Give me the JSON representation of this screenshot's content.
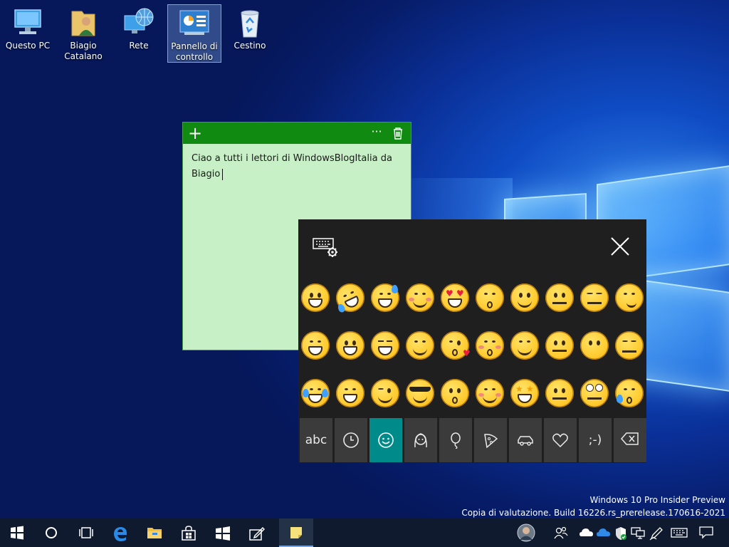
{
  "desktop": {
    "icons": [
      {
        "label": "Questo PC",
        "icon": "computer-icon"
      },
      {
        "label": "Biagio Catalano",
        "icon": "user-folder-icon"
      },
      {
        "label": "Rete",
        "icon": "network-icon"
      },
      {
        "label": "Pannello di controllo",
        "icon": "control-panel-icon",
        "selected": true
      },
      {
        "label": "Cestino",
        "icon": "recycle-bin-icon"
      }
    ]
  },
  "sticky_note": {
    "header_color": "#108a10",
    "body_color": "#c8f0c6",
    "add_icon": "plus-icon",
    "more_icon": "ellipsis-icon",
    "delete_icon": "trash-icon",
    "text_line1": "Ciao a tutti i lettori di WindowsBlogItalia da",
    "text_line2": "Biagio"
  },
  "emoji_keyboard": {
    "settings_icon": "keyboard-settings-icon",
    "close_icon": "close-icon",
    "emoji_rows": [
      [
        "grinning",
        "rofl",
        "sweat-smile",
        "smile-blush",
        "heart-eyes",
        "kissing-smiling",
        "slight-smile",
        "thinking",
        "expressionless",
        "smirk"
      ],
      [
        "grin",
        "smiley",
        "squint-laugh",
        "yum",
        "kiss-heart",
        "kissing-blush",
        "hug",
        "raised-brow",
        "no-mouth",
        "persevere"
      ],
      [
        "joy",
        "smile",
        "wink",
        "sunglasses",
        "kissing",
        "relaxed",
        "star-struck",
        "neutral",
        "eye-roll",
        "disappointed-relieved"
      ]
    ],
    "categories": [
      {
        "name": "abc",
        "label": "abc"
      },
      {
        "name": "recent",
        "icon": "clock-icon"
      },
      {
        "name": "smileys",
        "icon": "smiley-icon",
        "active": true
      },
      {
        "name": "people",
        "icon": "person-icon"
      },
      {
        "name": "celebration",
        "icon": "balloon-icon"
      },
      {
        "name": "food",
        "icon": "pizza-icon"
      },
      {
        "name": "travel",
        "icon": "car-icon"
      },
      {
        "name": "symbols",
        "icon": "heart-icon"
      },
      {
        "name": "emoticons",
        "label": ";-)"
      },
      {
        "name": "backspace",
        "icon": "backspace-icon"
      }
    ],
    "active_color": "#008b8b"
  },
  "watermark": {
    "line1": "Windows 10 Pro Insider Preview",
    "line2": "Copia di valutazione. Build 16226.rs_prerelease.170616-2021"
  },
  "taskbar": {
    "items": [
      "start-icon",
      "cortana-icon",
      "task-view-icon",
      "edge-icon",
      "file-explorer-icon",
      "store-icon",
      "windows-logo-app-icon",
      "ink-workspace-icon",
      "sticky-notes-icon"
    ],
    "tray": [
      "profile-avatar-icon",
      "people-icon",
      "onedrive-icon",
      "onedrive-blue-icon",
      "defender-icon",
      "network-icon",
      "pen-icon",
      "touch-keyboard-icon",
      "notifications-icon"
    ]
  }
}
